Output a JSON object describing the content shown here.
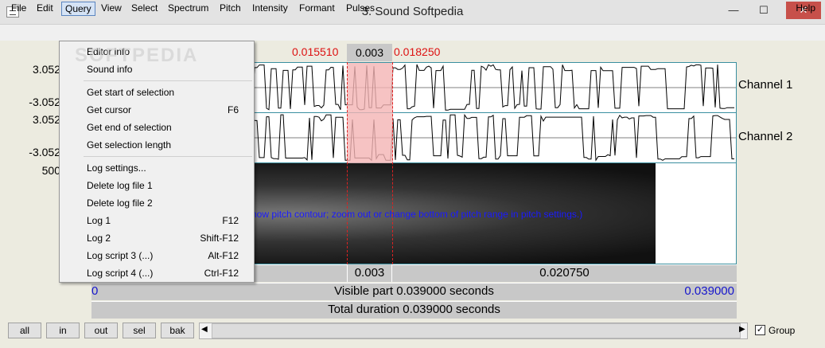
{
  "window": {
    "title": "3. Sound Softpedia",
    "minimize": "—",
    "maximize": "☐",
    "close": "✕"
  },
  "menubar": {
    "items": [
      {
        "id": "file",
        "label": "File"
      },
      {
        "id": "edit",
        "label": "Edit"
      },
      {
        "id": "query",
        "label": "Query"
      },
      {
        "id": "view",
        "label": "View"
      },
      {
        "id": "select",
        "label": "Select"
      },
      {
        "id": "spectrum",
        "label": "Spectrum"
      },
      {
        "id": "pitch",
        "label": "Pitch"
      },
      {
        "id": "intensity",
        "label": "Intensity"
      },
      {
        "id": "formant",
        "label": "Formant"
      },
      {
        "id": "pulses",
        "label": "Pulses"
      }
    ],
    "help": "Help"
  },
  "query_menu": {
    "items": [
      {
        "label": "Editor info",
        "shortcut": ""
      },
      {
        "label": "Sound info",
        "shortcut": ""
      },
      {
        "label": "Get start of selection",
        "shortcut": ""
      },
      {
        "label": "Get cursor",
        "shortcut": "F6"
      },
      {
        "label": "Get end of selection",
        "shortcut": ""
      },
      {
        "label": "Get selection length",
        "shortcut": ""
      },
      {
        "label": "Log settings...",
        "shortcut": ""
      },
      {
        "label": "Delete log file 1",
        "shortcut": ""
      },
      {
        "label": "Delete log file 2",
        "shortcut": ""
      },
      {
        "label": "Log 1",
        "shortcut": "F12"
      },
      {
        "label": "Log 2",
        "shortcut": "Shift-F12"
      },
      {
        "label": "Log script 3 (...)",
        "shortcut": "Alt-F12"
      },
      {
        "label": "Log script 4 (...)",
        "shortcut": "Ctrl-F12"
      }
    ]
  },
  "editor": {
    "selection_start": "0.015510",
    "selection_length": "0.003",
    "selection_end": "0.018250",
    "y_labels": {
      "ch1_top": "3.052",
      "ch1_bottom": "-3.052",
      "ch2_top": "3.052",
      "ch2_bottom": "-3.052",
      "spectro_top": "500"
    },
    "channel1": "Channel 1",
    "channel2": "Channel 2",
    "pitch_message": "how pitch contour; zoom out or change bottom of pitch range in pitch settings.)",
    "bottom_sel_length": "0.003",
    "bottom_right": "0.020750",
    "visible_start": "0",
    "visible_text": "Visible part 0.039000 seconds",
    "visible_end": "0.039000",
    "total_text": "Total duration 0.039000 seconds"
  },
  "buttons": {
    "all": "all",
    "in": "in",
    "out": "out",
    "sel": "sel",
    "bak": "bak"
  },
  "group": {
    "label": "Group",
    "checked": true
  },
  "watermark": "SOFTPEDIA"
}
